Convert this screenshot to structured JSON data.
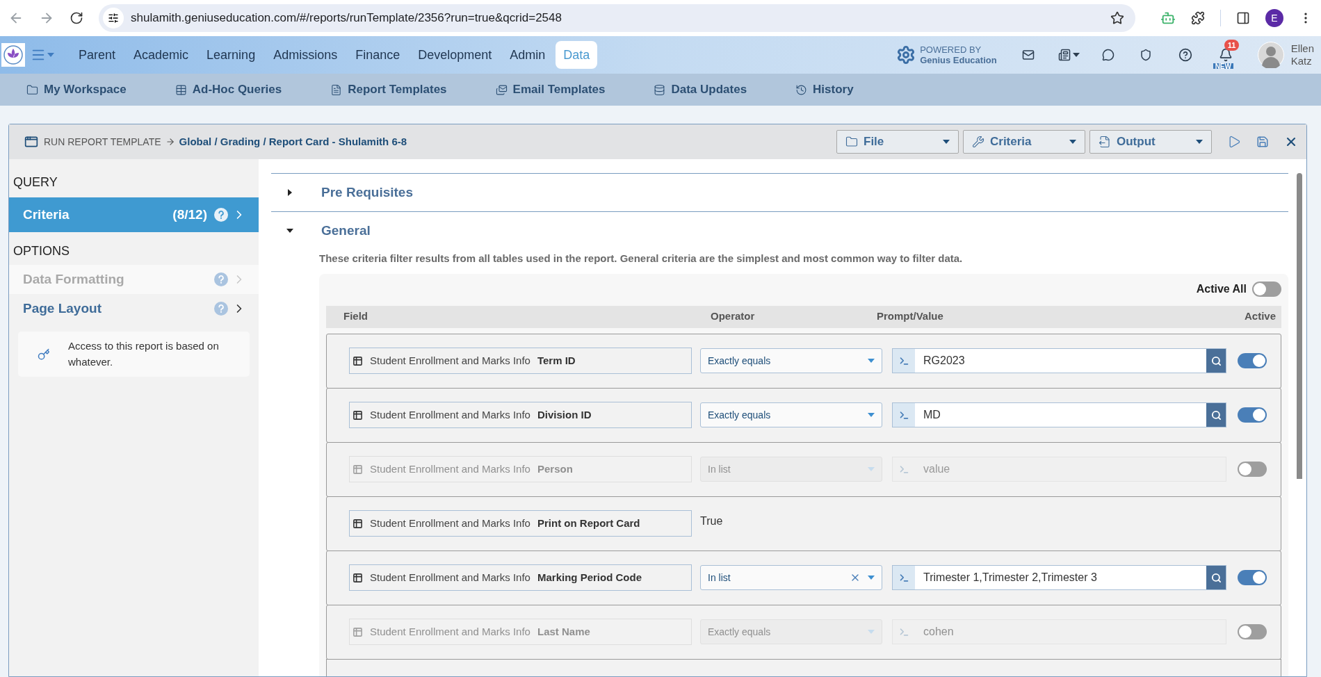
{
  "browser": {
    "url": "shulamith.geniuseducation.com/#/reports/runTemplate/2356?run=true&qcrid=2548",
    "profile_initial": "E"
  },
  "nav": {
    "items": [
      {
        "label": "Parent",
        "selected": false
      },
      {
        "label": "Academic",
        "selected": false
      },
      {
        "label": "Learning",
        "selected": false
      },
      {
        "label": "Admissions",
        "selected": false
      },
      {
        "label": "Finance",
        "selected": false
      },
      {
        "label": "Development",
        "selected": false
      },
      {
        "label": "Admin",
        "selected": false
      },
      {
        "label": "Data",
        "selected": true
      }
    ],
    "powered_by": {
      "line_1": "POWERED BY",
      "line_2": "Genius Education"
    },
    "notification_count": "11",
    "new_badge": "NEW",
    "user": {
      "first_name": "Ellen",
      "last_name": "Katz"
    }
  },
  "subnav": [
    {
      "label": "My Workspace",
      "kind": "folder"
    },
    {
      "label": "Ad-Hoc Queries",
      "kind": "grid"
    },
    {
      "label": "Report Templates",
      "kind": "document"
    },
    {
      "label": "Email Templates",
      "kind": "email"
    },
    {
      "label": "Data Updates",
      "kind": "database"
    },
    {
      "label": "History",
      "kind": "history"
    }
  ],
  "panel": {
    "breadcrumb": {
      "root": "RUN REPORT TEMPLATE",
      "path": "Global / Grading / Report Card - Shulamith 6-8"
    },
    "menus": [
      {
        "label": "File",
        "kind": "file"
      },
      {
        "label": "Criteria",
        "kind": "criteria"
      },
      {
        "label": "Output",
        "kind": "output"
      }
    ]
  },
  "sidebar": {
    "sections": [
      {
        "title": "QUERY",
        "items": [
          {
            "label": "Criteria",
            "count": "(8/12)",
            "selected": true,
            "disabled": false
          }
        ]
      },
      {
        "title": "OPTIONS",
        "items": [
          {
            "label": "Data Formatting",
            "selected": false,
            "disabled": true
          },
          {
            "label": "Page Layout",
            "selected": false,
            "disabled": false
          }
        ]
      }
    ],
    "notice": "Access to this report is based on whatever."
  },
  "content": {
    "sections": [
      {
        "title": "Pre Requisites",
        "expanded": false
      },
      {
        "title": "General",
        "expanded": true
      }
    ],
    "description": "These criteria filter results from all tables used in the report. General criteria are the simplest and most common way to filter data.",
    "active_all": {
      "label": "Active All",
      "on": false
    },
    "columns": [
      "Field",
      "Operator",
      "Prompt/Value",
      "Active"
    ],
    "rows": [
      {
        "kind": "select",
        "table": "Student Enrollment and Marks Info",
        "field": "Term ID",
        "operator": "Exactly equals",
        "clearable": false,
        "value": "RG2023",
        "active": true
      },
      {
        "kind": "select",
        "table": "Student Enrollment and Marks Info",
        "field": "Division ID",
        "operator": "Exactly equals",
        "clearable": false,
        "value": "MD",
        "active": true
      },
      {
        "kind": "select",
        "table": "Student Enrollment and Marks Info",
        "field": "Person",
        "operator": "In list",
        "clearable": false,
        "placeholder": "value",
        "active": false
      },
      {
        "kind": "static",
        "table": "Student Enrollment and Marks Info",
        "field": "Print on Report Card",
        "fixed_value": "True"
      },
      {
        "kind": "select",
        "table": "Student Enrollment and Marks Info",
        "field": "Marking Period Code",
        "operator": "In list",
        "clearable": true,
        "value": "Trimester 1,Trimester 2,Trimester 3",
        "active": true
      },
      {
        "kind": "select",
        "table": "Student Enrollment and Marks Info",
        "field": "Last Name",
        "operator": "Exactly equals",
        "clearable": false,
        "value": "cohen",
        "active": false
      }
    ]
  }
}
